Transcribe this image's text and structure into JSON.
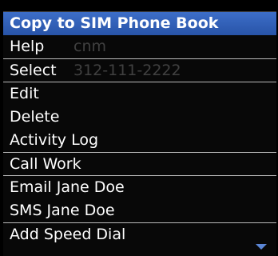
{
  "background": {
    "contact_name": "cnm",
    "contact_number": "312-111-2222"
  },
  "menu": {
    "items": [
      {
        "label": "Copy to SIM Phone Book",
        "selected": true,
        "separator_after": false
      },
      {
        "label": "Help",
        "selected": false,
        "separator_after": true
      },
      {
        "label": "Select",
        "selected": false,
        "separator_after": true
      },
      {
        "label": "Edit",
        "selected": false,
        "separator_after": false
      },
      {
        "label": "Delete",
        "selected": false,
        "separator_after": false
      },
      {
        "label": "Activity Log",
        "selected": false,
        "separator_after": true
      },
      {
        "label": "Call Work",
        "selected": false,
        "separator_after": true
      },
      {
        "label": "Email Jane Doe",
        "selected": false,
        "separator_after": false
      },
      {
        "label": "SMS Jane Doe",
        "selected": false,
        "separator_after": true
      },
      {
        "label": "Add Speed Dial",
        "selected": false,
        "separator_after": false
      }
    ],
    "scroll_indicator": "chevron-down-icon",
    "colors": {
      "selection": "#2d5cb4",
      "text": "#ffffff",
      "background": "#000000"
    }
  }
}
